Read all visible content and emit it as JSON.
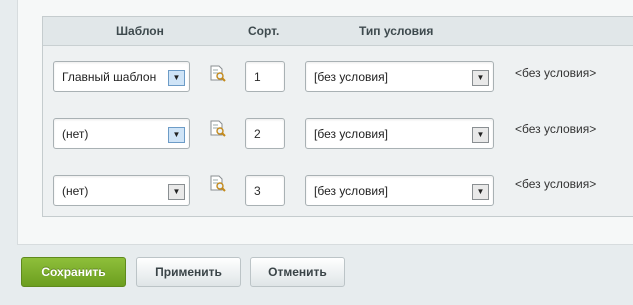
{
  "table": {
    "headers": {
      "template": "Шаблон",
      "sort": "Сорт.",
      "condition_type": "Тип условия"
    },
    "rows": [
      {
        "template": "Главный шаблон",
        "sort": "1",
        "condition_type": "[без условия]",
        "condition": "<без условия>"
      },
      {
        "template": "(нет)",
        "sort": "2",
        "condition_type": "[без условия]",
        "condition": "<без условия>"
      },
      {
        "template": "(нет)",
        "sort": "3",
        "condition_type": "[без условия]",
        "condition": "<без условия>"
      }
    ]
  },
  "buttons": {
    "save": "Сохранить",
    "apply": "Применить",
    "cancel": "Отменить"
  },
  "colors": {
    "save_button": "#7aab2a",
    "panel_bg": "#f6f8f8",
    "page_bg": "#e7ecee"
  },
  "icons": {
    "edit": "document-search-icon",
    "dropdown": "chevron-down-icon"
  }
}
